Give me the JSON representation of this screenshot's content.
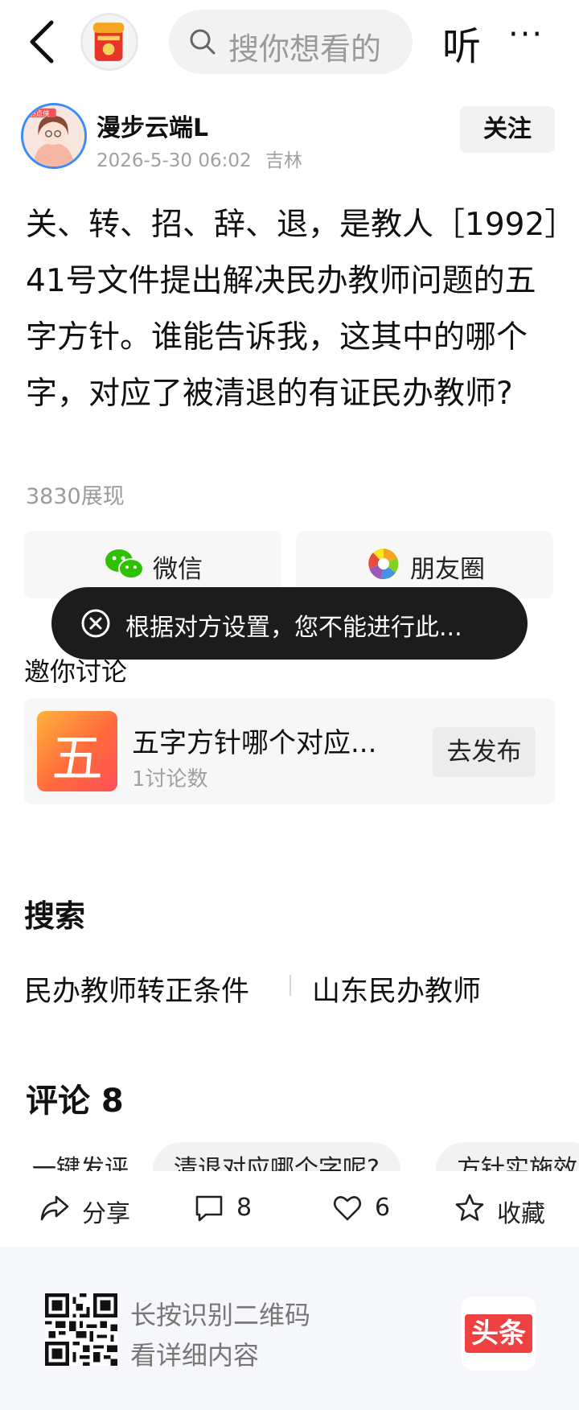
{
  "header": {
    "search_placeholder": "搜你想看的",
    "listen_label": "听",
    "more_label": "···"
  },
  "author": {
    "name": "漫步云端L",
    "timestamp": "2026-5-30 06:02",
    "location": "吉林",
    "follow_label": "关注",
    "avatar_badge": "热点侠"
  },
  "post": {
    "text": "关、转、招、辞、退，是教人［1992］41号文件提出解决民办教师问题的五字方针。谁能告诉我，这其中的哪个字，对应了被清退的有证民办教师?",
    "impressions": "3830展现"
  },
  "share": {
    "wechat_label": "微信",
    "moments_label": "朋友圈"
  },
  "toast": {
    "message": "根据对方设置，您不能进行此..."
  },
  "discussion": {
    "section_title": "邀你讨论",
    "thumb_char": "五",
    "title": "五字方针哪个对应...",
    "count": "1讨论数",
    "post_label": "去发布"
  },
  "search": {
    "title": "搜索",
    "suggestions": [
      "民办教师转正条件",
      "山东民办教师"
    ]
  },
  "comments": {
    "title": "评论 8",
    "chips": [
      "一键发评",
      "清退对应哪个字呢?",
      "方针实施效"
    ]
  },
  "actions": {
    "share_label": "分享",
    "comment_count": "8",
    "like_count": "6",
    "favorite_label": "收藏"
  },
  "footer": {
    "qr_line1": "长按识别二维码",
    "qr_line2": "看详细内容",
    "brand": "头条"
  },
  "colors": {
    "accent_blue": "#3a8cf6",
    "brand_red": "#f04142",
    "toast_bg": "#1c1c1c"
  }
}
